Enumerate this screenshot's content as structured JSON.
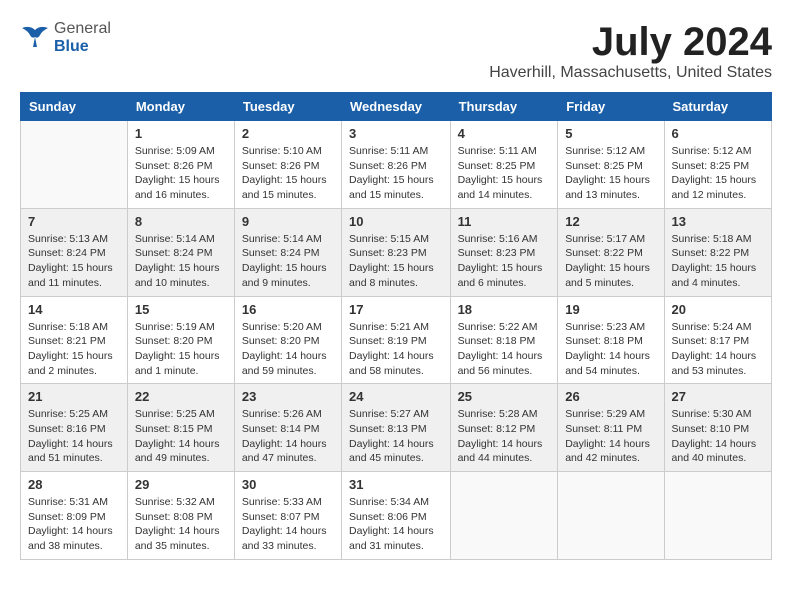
{
  "header": {
    "logo_general": "General",
    "logo_blue": "Blue",
    "month_title": "July 2024",
    "location": "Haverhill, Massachusetts, United States"
  },
  "calendar": {
    "days_of_week": [
      "Sunday",
      "Monday",
      "Tuesday",
      "Wednesday",
      "Thursday",
      "Friday",
      "Saturday"
    ],
    "weeks": [
      [
        {
          "day": "",
          "info": ""
        },
        {
          "day": "1",
          "info": "Sunrise: 5:09 AM\nSunset: 8:26 PM\nDaylight: 15 hours\nand 16 minutes."
        },
        {
          "day": "2",
          "info": "Sunrise: 5:10 AM\nSunset: 8:26 PM\nDaylight: 15 hours\nand 15 minutes."
        },
        {
          "day": "3",
          "info": "Sunrise: 5:11 AM\nSunset: 8:26 PM\nDaylight: 15 hours\nand 15 minutes."
        },
        {
          "day": "4",
          "info": "Sunrise: 5:11 AM\nSunset: 8:25 PM\nDaylight: 15 hours\nand 14 minutes."
        },
        {
          "day": "5",
          "info": "Sunrise: 5:12 AM\nSunset: 8:25 PM\nDaylight: 15 hours\nand 13 minutes."
        },
        {
          "day": "6",
          "info": "Sunrise: 5:12 AM\nSunset: 8:25 PM\nDaylight: 15 hours\nand 12 minutes."
        }
      ],
      [
        {
          "day": "7",
          "info": "Sunrise: 5:13 AM\nSunset: 8:24 PM\nDaylight: 15 hours\nand 11 minutes."
        },
        {
          "day": "8",
          "info": "Sunrise: 5:14 AM\nSunset: 8:24 PM\nDaylight: 15 hours\nand 10 minutes."
        },
        {
          "day": "9",
          "info": "Sunrise: 5:14 AM\nSunset: 8:24 PM\nDaylight: 15 hours\nand 9 minutes."
        },
        {
          "day": "10",
          "info": "Sunrise: 5:15 AM\nSunset: 8:23 PM\nDaylight: 15 hours\nand 8 minutes."
        },
        {
          "day": "11",
          "info": "Sunrise: 5:16 AM\nSunset: 8:23 PM\nDaylight: 15 hours\nand 6 minutes."
        },
        {
          "day": "12",
          "info": "Sunrise: 5:17 AM\nSunset: 8:22 PM\nDaylight: 15 hours\nand 5 minutes."
        },
        {
          "day": "13",
          "info": "Sunrise: 5:18 AM\nSunset: 8:22 PM\nDaylight: 15 hours\nand 4 minutes."
        }
      ],
      [
        {
          "day": "14",
          "info": "Sunrise: 5:18 AM\nSunset: 8:21 PM\nDaylight: 15 hours\nand 2 minutes."
        },
        {
          "day": "15",
          "info": "Sunrise: 5:19 AM\nSunset: 8:20 PM\nDaylight: 15 hours\nand 1 minute."
        },
        {
          "day": "16",
          "info": "Sunrise: 5:20 AM\nSunset: 8:20 PM\nDaylight: 14 hours\nand 59 minutes."
        },
        {
          "day": "17",
          "info": "Sunrise: 5:21 AM\nSunset: 8:19 PM\nDaylight: 14 hours\nand 58 minutes."
        },
        {
          "day": "18",
          "info": "Sunrise: 5:22 AM\nSunset: 8:18 PM\nDaylight: 14 hours\nand 56 minutes."
        },
        {
          "day": "19",
          "info": "Sunrise: 5:23 AM\nSunset: 8:18 PM\nDaylight: 14 hours\nand 54 minutes."
        },
        {
          "day": "20",
          "info": "Sunrise: 5:24 AM\nSunset: 8:17 PM\nDaylight: 14 hours\nand 53 minutes."
        }
      ],
      [
        {
          "day": "21",
          "info": "Sunrise: 5:25 AM\nSunset: 8:16 PM\nDaylight: 14 hours\nand 51 minutes."
        },
        {
          "day": "22",
          "info": "Sunrise: 5:25 AM\nSunset: 8:15 PM\nDaylight: 14 hours\nand 49 minutes."
        },
        {
          "day": "23",
          "info": "Sunrise: 5:26 AM\nSunset: 8:14 PM\nDaylight: 14 hours\nand 47 minutes."
        },
        {
          "day": "24",
          "info": "Sunrise: 5:27 AM\nSunset: 8:13 PM\nDaylight: 14 hours\nand 45 minutes."
        },
        {
          "day": "25",
          "info": "Sunrise: 5:28 AM\nSunset: 8:12 PM\nDaylight: 14 hours\nand 44 minutes."
        },
        {
          "day": "26",
          "info": "Sunrise: 5:29 AM\nSunset: 8:11 PM\nDaylight: 14 hours\nand 42 minutes."
        },
        {
          "day": "27",
          "info": "Sunrise: 5:30 AM\nSunset: 8:10 PM\nDaylight: 14 hours\nand 40 minutes."
        }
      ],
      [
        {
          "day": "28",
          "info": "Sunrise: 5:31 AM\nSunset: 8:09 PM\nDaylight: 14 hours\nand 38 minutes."
        },
        {
          "day": "29",
          "info": "Sunrise: 5:32 AM\nSunset: 8:08 PM\nDaylight: 14 hours\nand 35 minutes."
        },
        {
          "day": "30",
          "info": "Sunrise: 5:33 AM\nSunset: 8:07 PM\nDaylight: 14 hours\nand 33 minutes."
        },
        {
          "day": "31",
          "info": "Sunrise: 5:34 AM\nSunset: 8:06 PM\nDaylight: 14 hours\nand 31 minutes."
        },
        {
          "day": "",
          "info": ""
        },
        {
          "day": "",
          "info": ""
        },
        {
          "day": "",
          "info": ""
        }
      ]
    ]
  }
}
